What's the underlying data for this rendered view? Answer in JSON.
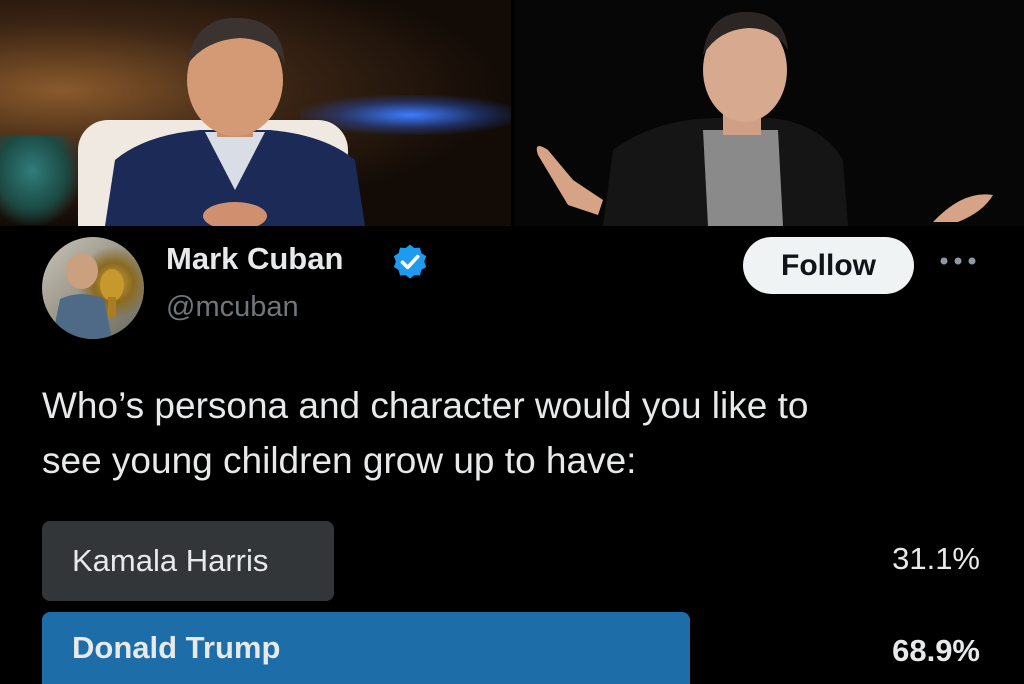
{
  "images": [
    {
      "name": "left-photo",
      "description_icon": "person-photo"
    },
    {
      "name": "right-photo",
      "description_icon": "person-photo"
    }
  ],
  "user": {
    "display_name": "Mark Cuban",
    "handle": "@mcuban",
    "verified_icon": "verified-badge-icon",
    "verified_color": "#1d9bf0"
  },
  "actions": {
    "follow_label": "Follow",
    "more_icon": "more-horizontal-icon"
  },
  "tweet": {
    "lines": [
      "Who’s persona and character would you like to",
      "see young children grow up to have:"
    ]
  },
  "poll": {
    "options": [
      {
        "label": "Kamala Harris",
        "percent": "31.1%",
        "fraction": 0.311,
        "color": "#333639"
      },
      {
        "label": "Donald Trump",
        "percent": "68.9%",
        "fraction": 0.689,
        "color": "#1d6ea8",
        "leading": true
      }
    ]
  }
}
